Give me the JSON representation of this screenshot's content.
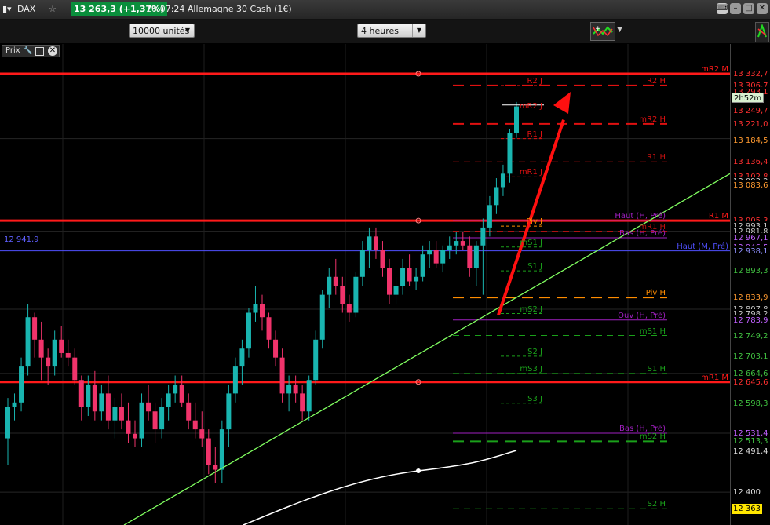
{
  "titlebar": {
    "symbol": "DAX",
    "quote": "13 263,3 (+1,37%)",
    "instrument": "10:07:24 Allemagne 30 Cash (1€)",
    "close_symbol": "✕",
    "star_symbol": "☆"
  },
  "toolbar": {
    "units": "10000 unités",
    "period": "4 heures"
  },
  "panel": {
    "prix_label": "Prix"
  },
  "colors": {
    "background": "#000000",
    "up": "#19b5b0",
    "down": "#f0336b",
    "red_line": "#ff1a1a",
    "pivot_purple": "#a020c0",
    "piv_orange": "#ff8c00",
    "green_line": "#1aa01a",
    "trend": "#80ff60",
    "arrow": "#ff1010",
    "highlight": "#00c94f"
  },
  "chart_data": {
    "type": "candlestick",
    "timeframe": "4 heures",
    "ylim": [
      12360,
      13345
    ],
    "left_marker": "12 941,9",
    "current_price": "13 263,3",
    "countdown": "2h52m",
    "axis_labels": [
      "13 332,7",
      "13 306,7",
      "13 293,1",
      "13 249,7",
      "13 221,0",
      "13 188,2",
      "13 184,5",
      "13 136,4",
      "13 102,8",
      "13 093,2",
      "13 083,6",
      "13 005,3",
      "12 993,1",
      "12 981,8",
      "12 967,1",
      "12 946,5",
      "12 938,1",
      "12 893,3",
      "12 833,9",
      "12 807,8",
      "12 798,2",
      "12 783,9",
      "12 749,2",
      "12 703,1",
      "12 664,6",
      "12 645,6",
      "12 598,3",
      "12 531,4",
      "12 513,3",
      "12 491,4",
      "12 400",
      "12 363"
    ],
    "levels": [
      {
        "label": "mR2 M",
        "value": 13332.7
      },
      {
        "label": "R2 J",
        "value": 13306.7
      },
      {
        "label": "R2 H",
        "value": 13306.7
      },
      {
        "label": "mR2 J",
        "value": 13249.7
      },
      {
        "label": "mR2 H",
        "value": 13221.0
      },
      {
        "label": "R1 J",
        "value": 13188.2
      },
      {
        "label": "R1 H",
        "value": 13136.4
      },
      {
        "label": "mR1 J",
        "value": 13102.8
      },
      {
        "label": "R1 M",
        "value": 13005.3
      },
      {
        "label": "Haut (H, Pré)",
        "value": 13005.3
      },
      {
        "label": "Piv J",
        "value": 12993.1
      },
      {
        "label": "mR1 H",
        "value": 12981.8
      },
      {
        "label": "Bas (H, Pré)",
        "value": 12967.1
      },
      {
        "label": "mS1 J",
        "value": 12946.5
      },
      {
        "label": "Haut (M, Pré)",
        "value": 12938.1
      },
      {
        "label": "S1 J",
        "value": 12893.3
      },
      {
        "label": "Piv H",
        "value": 12833.9
      },
      {
        "label": "mS2 J",
        "value": 12798.2
      },
      {
        "label": "Ouv (H, Pré)",
        "value": 12783.9
      },
      {
        "label": "mS1 H",
        "value": 12749.2
      },
      {
        "label": "S2 J",
        "value": 12703.1
      },
      {
        "label": "S1 H",
        "value": 12664.6
      },
      {
        "label": "mS3 J",
        "value": 12664.6
      },
      {
        "label": "mR1 M",
        "value": 12645.6
      },
      {
        "label": "S3 J",
        "value": 12598.3
      },
      {
        "label": "Bas (H, Pré)",
        "value": 12531.4
      },
      {
        "label": "mS2 H",
        "value": 12513.3
      },
      {
        "label": "S2 H",
        "value": 12363.0
      }
    ],
    "candles": [
      [
        12520,
        12610,
        12460,
        12590
      ],
      [
        12590,
        12620,
        12560,
        12600
      ],
      [
        12600,
        12700,
        12580,
        12680
      ],
      [
        12680,
        12820,
        12660,
        12790
      ],
      [
        12790,
        12800,
        12700,
        12740
      ],
      [
        12740,
        12780,
        12650,
        12700
      ],
      [
        12700,
        12720,
        12640,
        12680
      ],
      [
        12680,
        12760,
        12660,
        12740
      ],
      [
        12740,
        12770,
        12700,
        12710
      ],
      [
        12710,
        12740,
        12680,
        12700
      ],
      [
        12700,
        12720,
        12640,
        12650
      ],
      [
        12650,
        12660,
        12560,
        12590
      ],
      [
        12590,
        12660,
        12570,
        12640
      ],
      [
        12640,
        12670,
        12560,
        12580
      ],
      [
        12580,
        12640,
        12560,
        12620
      ],
      [
        12620,
        12660,
        12540,
        12560
      ],
      [
        12560,
        12610,
        12520,
        12590
      ],
      [
        12590,
        12620,
        12540,
        12560
      ],
      [
        12560,
        12600,
        12510,
        12530
      ],
      [
        12530,
        12560,
        12500,
        12520
      ],
      [
        12520,
        12620,
        12500,
        12600
      ],
      [
        12600,
        12640,
        12560,
        12580
      ],
      [
        12580,
        12600,
        12510,
        12540
      ],
      [
        12540,
        12610,
        12520,
        12590
      ],
      [
        12590,
        12640,
        12560,
        12620
      ],
      [
        12620,
        12660,
        12600,
        12640
      ],
      [
        12640,
        12660,
        12590,
        12600
      ],
      [
        12600,
        12620,
        12540,
        12560
      ],
      [
        12560,
        12600,
        12520,
        12540
      ],
      [
        12540,
        12580,
        12500,
        12520
      ],
      [
        12520,
        12540,
        12440,
        12460
      ],
      [
        12460,
        12500,
        12420,
        12450
      ],
      [
        12450,
        12560,
        12420,
        12540
      ],
      [
        12540,
        12640,
        12500,
        12620
      ],
      [
        12620,
        12700,
        12600,
        12680
      ],
      [
        12680,
        12740,
        12640,
        12720
      ],
      [
        12720,
        12810,
        12700,
        12800
      ],
      [
        12800,
        12860,
        12780,
        12820
      ],
      [
        12820,
        12840,
        12760,
        12790
      ],
      [
        12790,
        12800,
        12720,
        12740
      ],
      [
        12740,
        12760,
        12680,
        12700
      ],
      [
        12700,
        12720,
        12600,
        12620
      ],
      [
        12620,
        12660,
        12580,
        12640
      ],
      [
        12640,
        12660,
        12600,
        12620
      ],
      [
        12620,
        12640,
        12560,
        12580
      ],
      [
        12580,
        12660,
        12560,
        12650
      ],
      [
        12650,
        12760,
        12640,
        12740
      ],
      [
        12740,
        12850,
        12720,
        12840
      ],
      [
        12840,
        12900,
        12810,
        12880
      ],
      [
        12880,
        12920,
        12840,
        12860
      ],
      [
        12860,
        12880,
        12800,
        12820
      ],
      [
        12820,
        12840,
        12780,
        12800
      ],
      [
        12800,
        12890,
        12790,
        12880
      ],
      [
        12880,
        12960,
        12860,
        12940
      ],
      [
        12940,
        12990,
        12900,
        12970
      ],
      [
        12970,
        12990,
        12920,
        12940
      ],
      [
        12940,
        12960,
        12880,
        12900
      ],
      [
        12900,
        12920,
        12820,
        12840
      ],
      [
        12840,
        12880,
        12820,
        12860
      ],
      [
        12860,
        12920,
        12840,
        12900
      ],
      [
        12900,
        12930,
        12860,
        12870
      ],
      [
        12870,
        12900,
        12850,
        12880
      ],
      [
        12880,
        12950,
        12870,
        12930
      ],
      [
        12930,
        12960,
        12900,
        12940
      ],
      [
        12940,
        12960,
        12900,
        12910
      ],
      [
        12910,
        12950,
        12890,
        12940
      ],
      [
        12940,
        12970,
        12920,
        12950
      ],
      [
        12950,
        12980,
        12930,
        12960
      ],
      [
        12960,
        12980,
        12940,
        12950
      ],
      [
        12950,
        12970,
        12880,
        12900
      ],
      [
        12900,
        12960,
        12860,
        12950
      ],
      [
        12950,
        13010,
        12840,
        12990
      ],
      [
        12990,
        13060,
        12970,
        13040
      ],
      [
        13040,
        13100,
        13020,
        13080
      ],
      [
        13080,
        13130,
        13060,
        13110
      ],
      [
        13110,
        13210,
        13090,
        13200
      ],
      [
        13200,
        13270,
        13190,
        13260
      ]
    ]
  }
}
